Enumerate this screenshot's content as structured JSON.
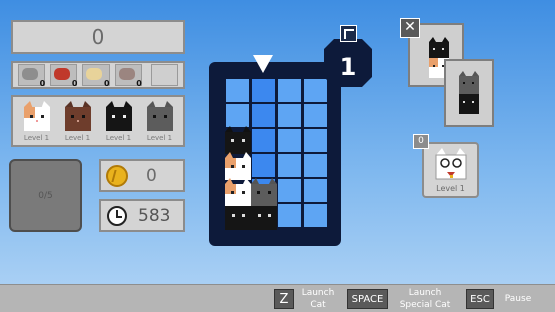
{
  "score": "0",
  "items": [
    {
      "name": "gray-cat-item",
      "count": "0",
      "color": "#8e8e8e"
    },
    {
      "name": "fish-item",
      "count": "0",
      "color": "#c0392b"
    },
    {
      "name": "bone-item",
      "count": "0",
      "color": "#e8d39a"
    },
    {
      "name": "mouse-item",
      "count": "0",
      "color": "#9b8580"
    }
  ],
  "cat_levels": [
    {
      "name": "calico-cat",
      "level": "Level 1"
    },
    {
      "name": "brown-cat",
      "level": "Level 1"
    },
    {
      "name": "black-cat",
      "level": "Level 1"
    },
    {
      "name": "gray-cat",
      "level": "Level 1"
    }
  ],
  "gray_box_label": "0/5",
  "coins": "0",
  "time": "583",
  "drop_counter": "1",
  "special_cat": {
    "badge": "0",
    "level": "Level 1"
  },
  "close_label": "✕",
  "controls": [
    {
      "key": "Z",
      "action": "Launch Cat"
    },
    {
      "key": "SPACE",
      "action": "Launch Special Cat"
    },
    {
      "key": "ESC",
      "action": "Pause"
    }
  ]
}
